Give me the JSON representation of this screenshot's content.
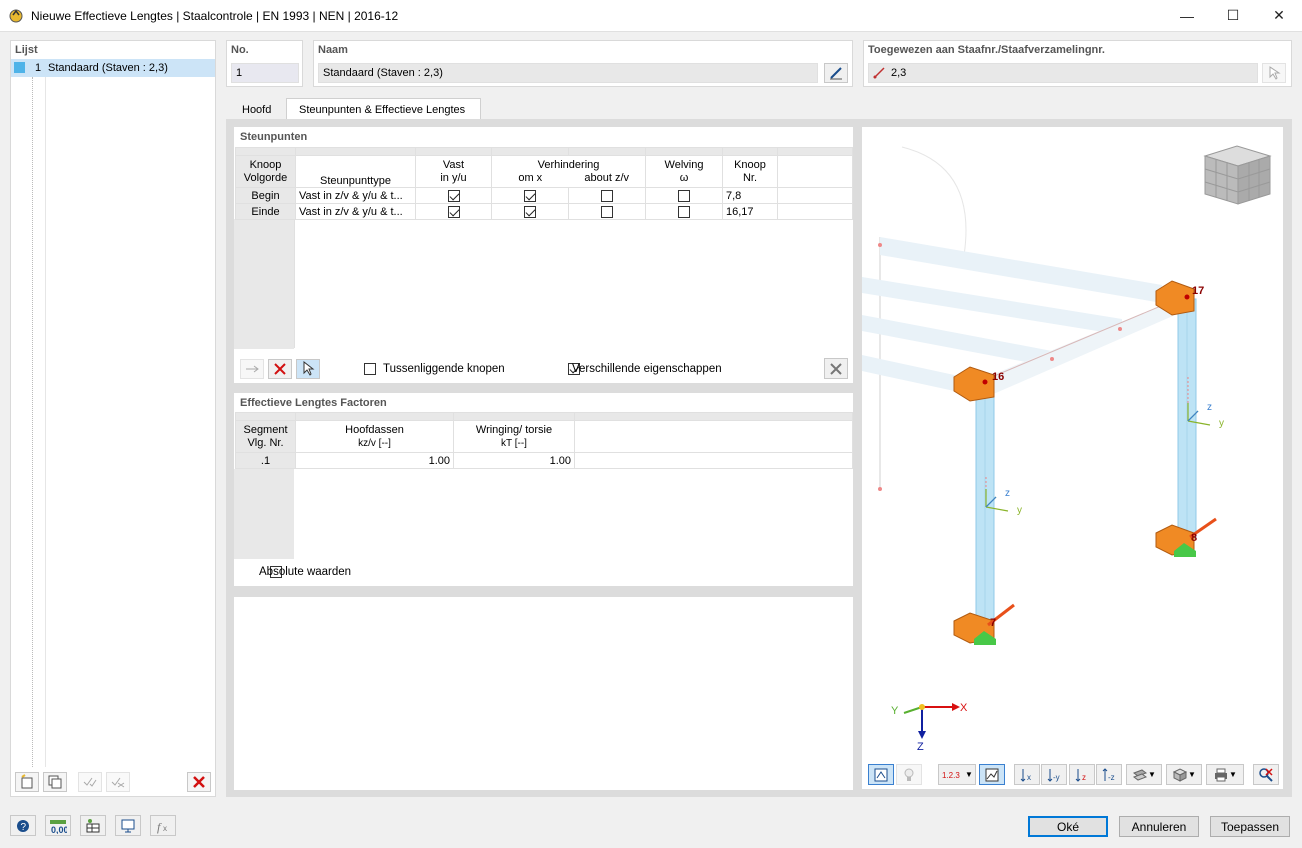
{
  "window": {
    "title": "Nieuwe Effectieve Lengtes | Staalcontrole | EN 1993 | NEN | 2016-12"
  },
  "list": {
    "header": "Lijst",
    "items": [
      {
        "num": "1",
        "label": "Standaard (Staven : 2,3)"
      }
    ]
  },
  "no": {
    "label": "No.",
    "value": "1"
  },
  "naam": {
    "label": "Naam",
    "value": "Standaard (Staven : 2,3)"
  },
  "assigned": {
    "label": "Toegewezen aan Staafnr./Staafverzamelingnr.",
    "value": "2,3"
  },
  "tabs": [
    "Hoofd",
    "Steunpunten & Effectieve Lengtes"
  ],
  "steunpunten": {
    "title": "Steunpunten",
    "headers": {
      "knoop": "Knoop",
      "volgorde": "Volgorde",
      "type": "Steunpunttype",
      "vast": "Vast",
      "in_yu": "in y/u",
      "verhindering": "Verhindering",
      "om_x": "om x",
      "about_zv": "about z/v",
      "welving": "Welving",
      "omega": "ω",
      "knoop2": "Knoop",
      "nr": "Nr."
    },
    "rows": [
      {
        "label": "Begin",
        "type": "Vast in z/v & y/u & t...",
        "nodes": "7,8"
      },
      {
        "label": "Einde",
        "type": "Vast in z/v & y/u & t...",
        "nodes": "16,17"
      }
    ],
    "opt_tussen": "Tussenliggende knopen",
    "opt_versch": "Verschillende eigenschappen"
  },
  "factoren": {
    "title": "Effectieve Lengtes Factoren",
    "headers": {
      "segment": "Segment",
      "vlg": "Vlg. Nr.",
      "hoofd": "Hoofdassen",
      "kzv": "kz/v [--]",
      "wring": "Wringing/ torsie",
      "kt": "kT [--]"
    },
    "rows": [
      {
        "label": ".1",
        "kzv": "1.00",
        "kt": "1.00"
      }
    ],
    "opt_abs": "Absolute waarden"
  },
  "view3d": {
    "nodes": [
      "16",
      "17",
      "8",
      "7"
    ],
    "axes": {
      "x": "X",
      "y": "Y",
      "z": "Z"
    },
    "local": {
      "y": "y",
      "z": "z"
    }
  },
  "buttons": {
    "ok": "Oké",
    "cancel": "Annuleren",
    "apply": "Toepassen"
  },
  "colors": {
    "selection": "#cce4f7",
    "member": "#bde3f5",
    "support": "#f08a24",
    "ok_border": "#0078d7"
  }
}
